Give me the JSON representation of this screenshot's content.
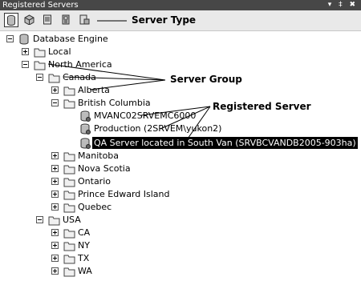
{
  "window": {
    "title": "Registered Servers",
    "buttons": "▾ ‡ ✖"
  },
  "toolbar": {
    "items": [
      "database-engine-icon",
      "analysis-services-icon",
      "reporting-services-icon",
      "integration-services-icon",
      "sql-mobile-icon"
    ]
  },
  "tree": {
    "root": "Database Engine",
    "local": "Local",
    "north_america": "North America",
    "canada": "Canada",
    "alberta": "Alberta",
    "british_columbia": "British Columbia",
    "server1": "MVANC02SRVEMC6000",
    "server2": "Production (2SRVEM\\yukon2)",
    "server3": "QA Server located in South Van (SRVBCVANDB2005-903ha)",
    "manitoba": "Manitoba",
    "nova_scotia": "Nova Scotia",
    "ontario": "Ontario",
    "pei": "Prince Edward Island",
    "quebec": "Quebec",
    "usa": "USA",
    "ca": "CA",
    "ny": "NY",
    "tx": "TX",
    "wa": "WA"
  },
  "callouts": {
    "server_type": "Server Type",
    "server_group": "Server Group",
    "registered_server": "Registered Server"
  }
}
